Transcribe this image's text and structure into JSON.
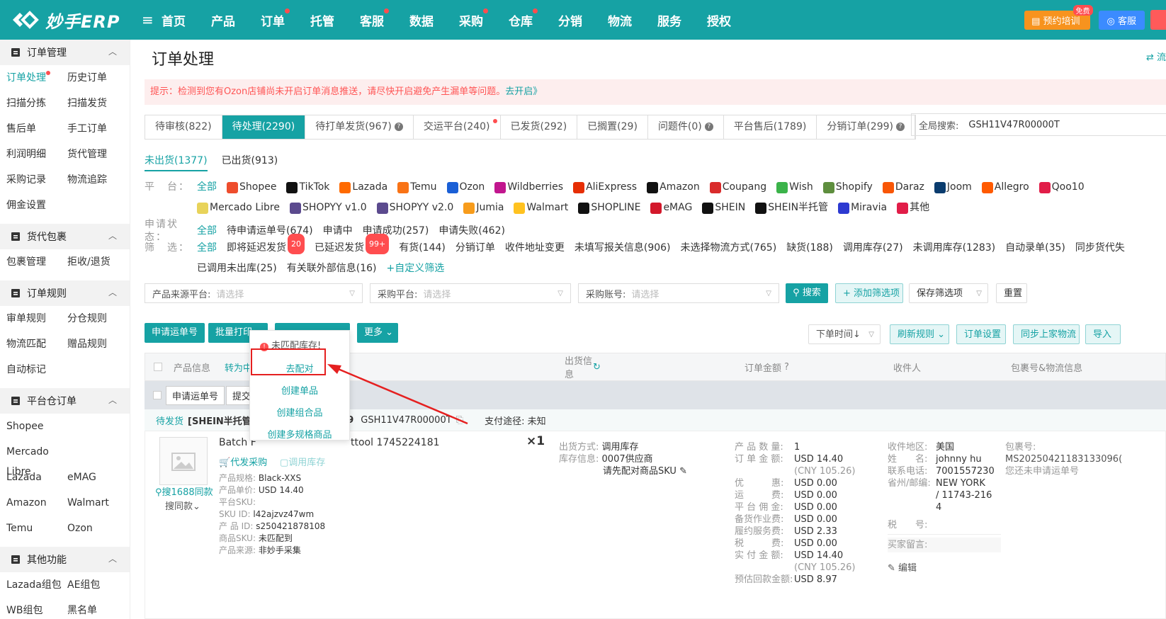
{
  "brand": {
    "name": "妙手ERP"
  },
  "nav": {
    "items": [
      "首页",
      "产品",
      "订单",
      "托管",
      "客服",
      "数据",
      "采购",
      "仓库",
      "分销",
      "物流",
      "服务",
      "授权"
    ],
    "dots": [
      false,
      false,
      true,
      false,
      true,
      false,
      true,
      true,
      false,
      false,
      false,
      false
    ],
    "train": "预约培训",
    "train_badge": "免费",
    "service": "客服"
  },
  "sidebar": {
    "sections": [
      {
        "title": "订单管理",
        "items": [
          "订单处理",
          "历史订单",
          "扫描分拣",
          "扫描发货",
          "售后单",
          "手工订单",
          "利润明细",
          "货代管理",
          "采购记录",
          "物流追踪",
          "佣金设置"
        ]
      },
      {
        "title": "货代包裹",
        "items": [
          "包裹管理",
          "拒收/退货"
        ]
      },
      {
        "title": "订单规则",
        "items": [
          "审单规则",
          "分仓规则",
          "物流匹配",
          "赠品规则",
          "自动标记"
        ]
      },
      {
        "title": "平台仓订单",
        "items": [
          "Shopee",
          "",
          "Mercado Libre",
          "",
          "Lazada",
          "eMAG",
          "Amazon",
          "Walmart",
          "Temu",
          "Ozon"
        ]
      },
      {
        "title": "其他功能",
        "items": [
          "Lazada组包",
          "AE组包",
          "WB组包",
          "黑名单"
        ]
      }
    ]
  },
  "page": {
    "title": "订单处理",
    "right_link": "流"
  },
  "notice": {
    "text": "提示：检测到您有Ozon店铺尚未开启订单消息推送，请尽快开启避免产生漏单等问题。",
    "link": "去开启》"
  },
  "tabs": [
    {
      "label": "待审核(822)"
    },
    {
      "label": "待处理(2290)",
      "active": true
    },
    {
      "label": "待打单发货(967)",
      "q": true
    },
    {
      "label": "交运平台(240)",
      "dot": true
    },
    {
      "label": "已发货(292)"
    },
    {
      "label": "已搁置(29)"
    },
    {
      "label": "问题件(0)",
      "q": true
    },
    {
      "label": "平台售后(1789)"
    },
    {
      "label": "分销订单(299)",
      "q": true
    }
  ],
  "global_search": {
    "label": "全局搜索:",
    "value": "GSH11V47R00000T"
  },
  "subtabs": [
    "未出货(1377)",
    "已出货(913)"
  ],
  "platform_label": "平　台：",
  "platforms": [
    "全部",
    "Shopee",
    "TikTok",
    "Lazada",
    "Temu",
    "Ozon",
    "Wildberries",
    "AliExpress",
    "Amazon",
    "Coupang",
    "Wish",
    "Shopify",
    "Daraz",
    "Joom",
    "Allegro",
    "Qoo10",
    "Mercado Libre",
    "SHOPYY v1.0",
    "SHOPYY v2.0",
    "Jumia",
    "Walmart",
    "SHOPLINE",
    "eMAG",
    "SHEIN",
    "SHEIN半托管",
    "Miravia",
    "其他"
  ],
  "platform_colors": [
    "",
    "#ee4d2d",
    "#111",
    "#ff6a00",
    "#f97316",
    "#1a5fd6",
    "#c1168e",
    "#e62e04",
    "#111",
    "#d92b2b",
    "#3bb34a",
    "#5e8e3e",
    "#f85606",
    "#0a3c6e",
    "#ff5a00",
    "#e11d48",
    "#e8d35a",
    "#5b4a8e",
    "#5b4a8e",
    "#f79c1c",
    "#ffc220",
    "#111",
    "#d3182b",
    "#111",
    "#111",
    "#2d3ad1",
    "#e11d48"
  ],
  "status_label": "申请状态：",
  "status": [
    "全部",
    "待申请运单号(674)",
    "申请中",
    "申请成功(257)",
    "申请失败(462)"
  ],
  "filter_label": "筛　选：",
  "filters": [
    "全部",
    "即将延迟发货",
    "已延迟发货",
    "有货(144)",
    "分销订单",
    "收件地址变更",
    "未填写报关信息(906)",
    "未选择物流方式(765)",
    "缺货(188)",
    "调用库存(27)",
    "未调用库存(1283)",
    "自动录单(35)",
    "同步货代失",
    "已调用未出库(25)",
    "有关联外部信息(16)",
    "+自定义筛选"
  ],
  "filter_badges": {
    "即将延迟发货": "20",
    "已延迟发货": "99+"
  },
  "selects": [
    {
      "label": "产品来源平台:",
      "ph": "请选择"
    },
    {
      "label": "采购平台:",
      "ph": "请选择"
    },
    {
      "label": "采购账号:",
      "ph": "请选择"
    }
  ],
  "buttons": {
    "search": "搜索",
    "add_filter": "+ 添加筛选项",
    "save_filter": "保存筛选项",
    "reset": "重置",
    "apply": "申请运单号",
    "batch_print": "批量打印",
    "more": "更多",
    "order_time": "下单时间↓",
    "refresh_rules": "刷新规则",
    "order_settings": "订单设置",
    "sync_logistics": "同步上家物流",
    "import": "导入"
  },
  "table_head": {
    "product": "产品信息",
    "convert": "转为中",
    "ship": "出货信息",
    "amount": "订单金额",
    "receiver": "收件人",
    "package": "包裹号&物流信息"
  },
  "bulk": {
    "apply": "申请运单号",
    "submit": "提交"
  },
  "order": {
    "status": "待发货",
    "shop": "[SHEIN半托管-",
    "shop_tail": "9",
    "order_no": "GSH11V47R00000T",
    "pay": "支付途径: 未知",
    "title": "Batch F",
    "title_tail": "ttool 1745224181",
    "qty": "×1",
    "purchase": "代发采购",
    "stock": "调用库存",
    "search1688": "搜1688同款",
    "search_same": "搜同款",
    "fields": [
      [
        "产品规格:",
        "Black-XXS"
      ],
      [
        "产品单价:",
        "USD 14.40"
      ],
      [
        "平台SKU:",
        ""
      ],
      [
        "SKU ID:",
        "l42ajzvz47wm"
      ],
      [
        "产 品 ID:",
        "s250421878108"
      ],
      [
        "商品SKU:",
        "未匹配到"
      ],
      [
        "产品来源:",
        "非妙手采集"
      ]
    ],
    "ship_method": [
      "出货方式:",
      "调用库存"
    ],
    "stock_info": [
      "库存信息:",
      "0007供应商"
    ],
    "stock_note": "请先配对商品SKU",
    "amounts": [
      [
        "产 品 数 量:",
        "1"
      ],
      [
        "订 单 金 额:",
        "USD 14.40"
      ],
      [
        "",
        "(CNY 105.26)"
      ],
      [
        "优　　　惠:",
        "USD 0.00"
      ],
      [
        "运　　　费:",
        "USD 0.00"
      ],
      [
        "平 台 佣 金:",
        "USD 0.00"
      ],
      [
        "备货作业费:",
        "USD 0.00"
      ],
      [
        "履约服务费:",
        "USD 2.33"
      ],
      [
        "税　　　费:",
        "USD 0.00"
      ],
      [
        "实 付 金 额:",
        "USD 14.40"
      ],
      [
        "",
        "(CNY 105.26)"
      ],
      [
        "预估回款金额:",
        "USD 8.97"
      ]
    ],
    "receiver": [
      [
        "收件地区:",
        "美国"
      ],
      [
        "姓　　名:",
        "johnny hu"
      ],
      [
        "联系电话:",
        "7001557230"
      ],
      [
        "省州/邮编:",
        "NEW YORK"
      ],
      [
        "",
        "/ 11743-216"
      ],
      [
        "",
        "4"
      ]
    ],
    "tax": "税　　号:",
    "buyer_msg": "买家留言:",
    "edit": "编辑",
    "package": [
      "包裹号:",
      "MS20250421183133096(",
      "您还未申请运单号"
    ]
  },
  "popup": {
    "header": "未匹配库存!",
    "links": [
      "去配对",
      "创建单品",
      "创建组合品",
      "创建多规格商品"
    ]
  }
}
